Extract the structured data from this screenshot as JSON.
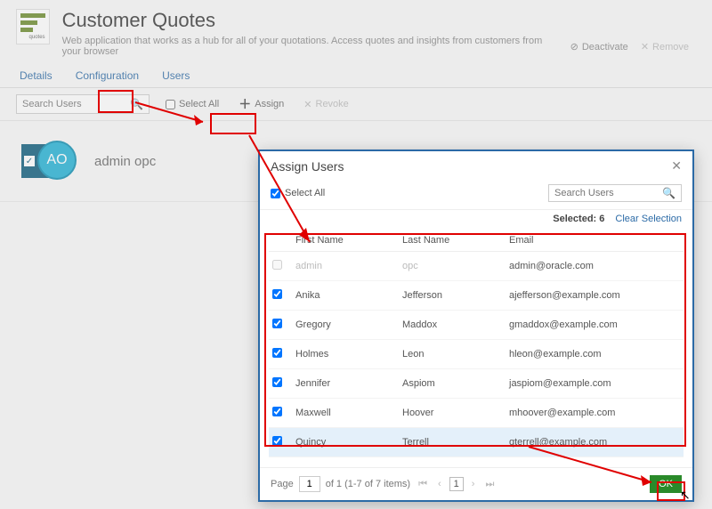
{
  "header": {
    "title": "Customer Quotes",
    "subtitle": "Web application that works as a hub for all of your quotations. Access quotes and insights from customers from your browser",
    "deactivate_label": "Deactivate",
    "remove_label": "Remove"
  },
  "tabs": {
    "details": "Details",
    "configuration": "Configuration",
    "users": "Users"
  },
  "toolbar": {
    "search_placeholder": "Search Users",
    "select_all_label": "Select All",
    "assign_label": "Assign",
    "revoke_label": "Revoke"
  },
  "user_card": {
    "initials": "AO",
    "name": "admin opc"
  },
  "modal": {
    "title": "Assign Users",
    "select_all_label": "Select All",
    "search_placeholder": "Search Users",
    "selected_label": "Selected:",
    "selected_count": "6",
    "clear_label": "Clear Selection",
    "columns": {
      "first": "First Name",
      "last": "Last Name",
      "email": "Email"
    },
    "rows": [
      {
        "checked": false,
        "disabled": true,
        "selected": false,
        "first": "admin",
        "last": "opc",
        "email": "admin@oracle.com"
      },
      {
        "checked": true,
        "disabled": false,
        "selected": false,
        "first": "Anika",
        "last": "Jefferson",
        "email": "ajefferson@example.com"
      },
      {
        "checked": true,
        "disabled": false,
        "selected": false,
        "first": "Gregory",
        "last": "Maddox",
        "email": "gmaddox@example.com"
      },
      {
        "checked": true,
        "disabled": false,
        "selected": false,
        "first": "Holmes",
        "last": "Leon",
        "email": "hleon@example.com"
      },
      {
        "checked": true,
        "disabled": false,
        "selected": false,
        "first": "Jennifer",
        "last": "Aspiom",
        "email": "jaspiom@example.com"
      },
      {
        "checked": true,
        "disabled": false,
        "selected": false,
        "first": "Maxwell",
        "last": "Hoover",
        "email": "mhoover@example.com"
      },
      {
        "checked": true,
        "disabled": false,
        "selected": true,
        "first": "Quincy",
        "last": "Terrell",
        "email": "qterrell@example.com"
      }
    ],
    "pagination": {
      "page_label": "Page",
      "page_value": "1",
      "of_text": "of 1 (1-7 of 7 items)",
      "current_page": "1"
    },
    "ok_label": "OK"
  }
}
